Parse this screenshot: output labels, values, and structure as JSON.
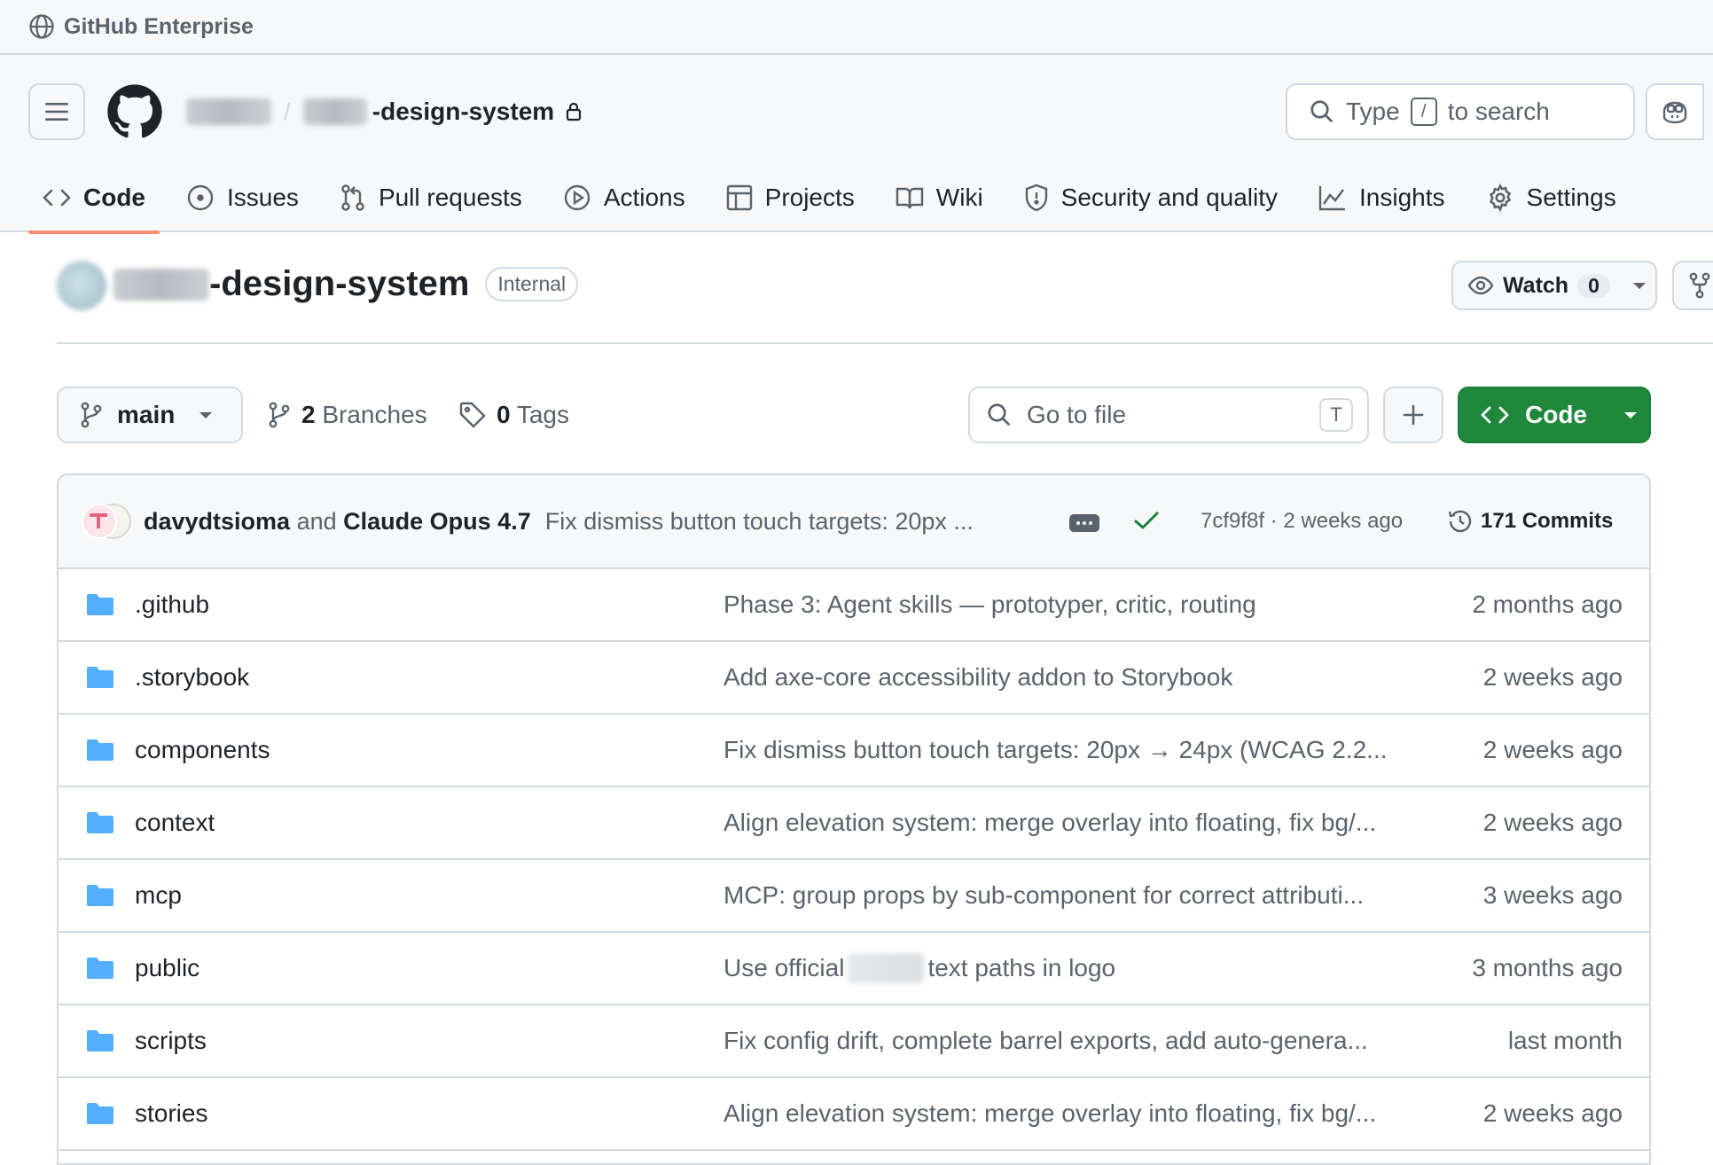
{
  "enterprise": {
    "label": "GitHub Enterprise"
  },
  "header": {
    "repo_name": "-design-system",
    "search": {
      "prefix": "Type",
      "key": "/",
      "suffix": "to search"
    }
  },
  "tabs": [
    {
      "label": "Code",
      "icon": "code-icon",
      "active": true
    },
    {
      "label": "Issues",
      "icon": "issue-icon"
    },
    {
      "label": "Pull requests",
      "icon": "pull-request-icon"
    },
    {
      "label": "Actions",
      "icon": "play-icon"
    },
    {
      "label": "Projects",
      "icon": "table-icon"
    },
    {
      "label": "Wiki",
      "icon": "book-icon"
    },
    {
      "label": "Security and quality",
      "icon": "shield-icon"
    },
    {
      "label": "Insights",
      "icon": "graph-icon"
    },
    {
      "label": "Settings",
      "icon": "gear-icon"
    }
  ],
  "repo": {
    "title": "-design-system",
    "visibility": "Internal",
    "watch_label": "Watch",
    "watch_count": "0"
  },
  "toolbar": {
    "branch": "main",
    "branches_count": "2",
    "branches_label": "Branches",
    "tags_count": "0",
    "tags_label": "Tags",
    "go_to_file": "Go to file",
    "go_to_file_key": "T",
    "code_label": "Code"
  },
  "latest_commit": {
    "author1": "davydtsioma",
    "and": "and",
    "author2": "Claude Opus 4.7",
    "message": "Fix dismiss button touch targets: 20px ...",
    "sha_age": "7cf9f8f · 2 weeks ago",
    "commits_label": "171 Commits"
  },
  "files": [
    {
      "name": ".github",
      "message": "Phase 3: Agent skills — prototyper, critic, routing",
      "age": "2 months ago"
    },
    {
      "name": ".storybook",
      "message": "Add axe-core accessibility addon to Storybook",
      "age": "2 weeks ago"
    },
    {
      "name": "components",
      "message": "Fix dismiss button touch targets: 20px → 24px (WCAG 2.2...",
      "age": "2 weeks ago"
    },
    {
      "name": "context",
      "message": "Align elevation system: merge overlay into floating, fix bg/...",
      "age": "2 weeks ago"
    },
    {
      "name": "mcp",
      "message": "MCP: group props by sub-component for correct attributi...",
      "age": "3 weeks ago"
    },
    {
      "name": "public",
      "message_prefix": "Use official",
      "message_suffix": "text paths in logo",
      "age": "3 months ago"
    },
    {
      "name": "scripts",
      "message": "Fix config drift, complete barrel exports, add auto-genera...",
      "age": "last month"
    },
    {
      "name": "stories",
      "message": "Align elevation system: merge overlay into floating, fix bg/...",
      "age": "2 weeks ago"
    }
  ],
  "colors": {
    "accent_tab": "#fd8c73",
    "code_button": "#1f883d",
    "folder": "#54aeff",
    "success": "#1a7f37"
  }
}
